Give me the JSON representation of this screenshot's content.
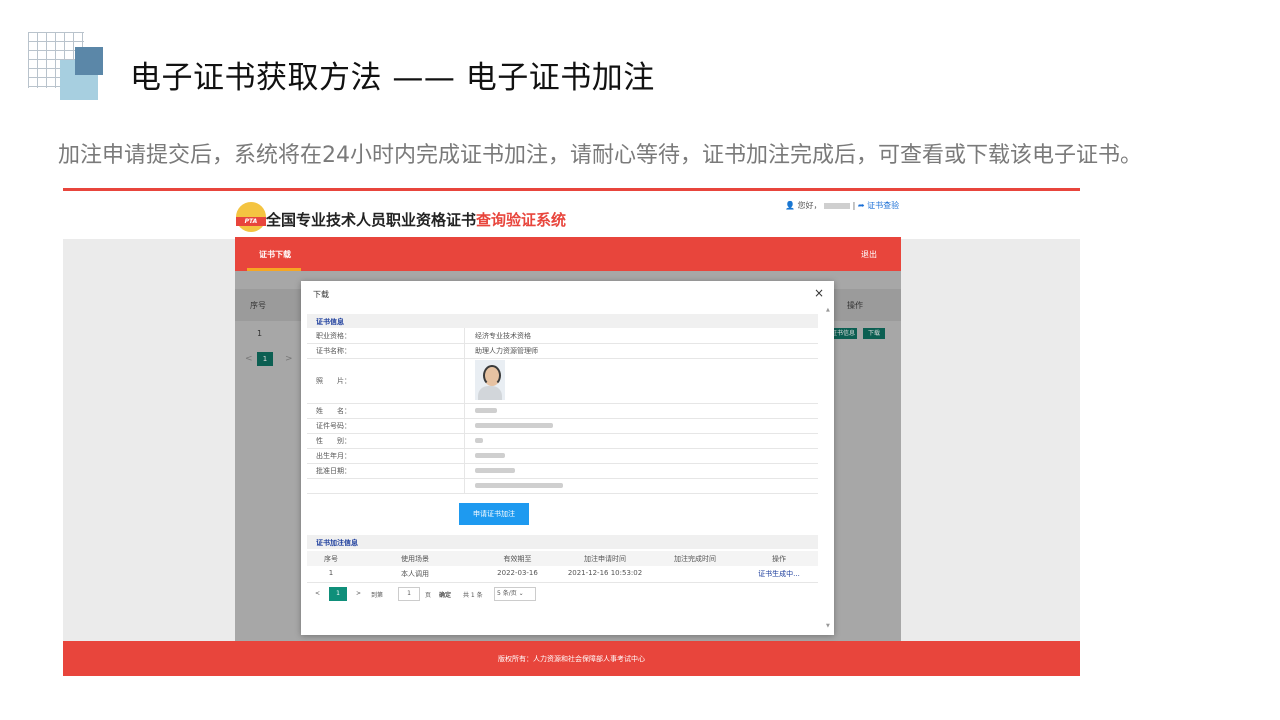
{
  "slide": {
    "title": "电子证书获取方法 —— 电子证书加注",
    "subtitle": "加注申请提交后，系统将在24小时内完成证书加注，请耐心等待，证书加注完成后，可查看或下载该电子证书。"
  },
  "site": {
    "logo_text": "PTA",
    "title_main": "全国专业技术人员职业资格证书",
    "title_red": "查询验证系统",
    "greeting": "您好，",
    "separator": "|",
    "verify_link": "证书查验",
    "nav_left": "证书下载",
    "nav_right": "退出",
    "footer": "版权所有：人力资源和社会保障部人事考试中心"
  },
  "bg_table": {
    "col_no": "序号",
    "col_op": "操作",
    "row_no": "1",
    "btn_info": "证书信息",
    "btn_download": "下载",
    "page": "1",
    "prev": "<",
    "next": ">"
  },
  "modal": {
    "title": "下载",
    "close": "×",
    "cert_section": "证书信息",
    "fields": [
      {
        "label": "职业资格：",
        "value": "经济专业技术资格"
      },
      {
        "label": "证书名称：",
        "value": "助理人力资源管理师"
      },
      {
        "label": "照　　片：",
        "value": ""
      },
      {
        "label": "姓　　名：",
        "value": ""
      },
      {
        "label": "证件号码：",
        "value": ""
      },
      {
        "label": "性　　别：",
        "value": ""
      },
      {
        "label": "出生年月：",
        "value": ""
      },
      {
        "label": "批准日期：",
        "value": ""
      }
    ],
    "apply_button": "申请证书加注",
    "note_section": "证书加注信息",
    "table_headers": [
      "序号",
      "使用场景",
      "有效期至",
      "加注申请时间",
      "加注完成时间",
      "操作"
    ],
    "table_row": [
      "1",
      "本人调用",
      "2022-03-16",
      "2021-12-16 10:53:02",
      "",
      "证书生成中..."
    ],
    "pager": {
      "prev": "<",
      "current": "1",
      "next": ">",
      "goto": "到第",
      "goto_value": "1",
      "page_unit": "页",
      "confirm": "确定",
      "total": "共 1 条",
      "per_page": "5 条/页"
    }
  },
  "colors": {
    "brand_red": "#e8453c",
    "teal": "#0f8f7a",
    "link_blue": "#1b3c9c",
    "button_blue": "#1e9af0"
  }
}
